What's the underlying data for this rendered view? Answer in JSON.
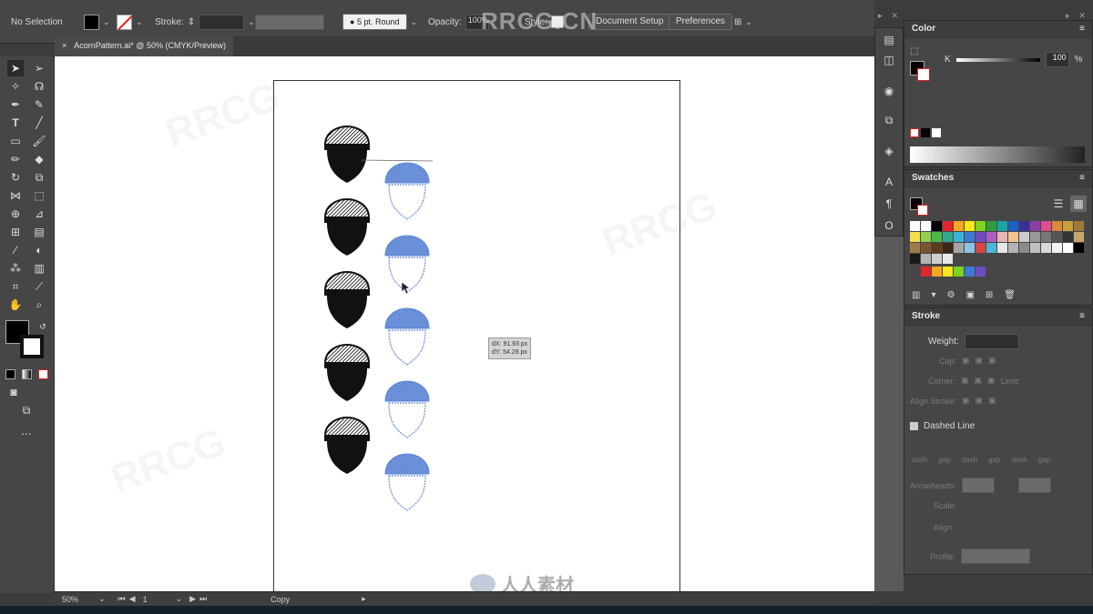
{
  "control_bar": {
    "selection": "No Selection",
    "stroke_label": "Stroke:",
    "brush": "5 pt. Round",
    "opacity_label": "Opacity:",
    "opacity_value": "100%",
    "style_label": "Style:",
    "document_setup": "Document Setup",
    "preferences": "Preferences"
  },
  "watermark": "RRCG.CN",
  "doc_tab": {
    "title": "AcornPattern.ai* @ 50% (CMYK/Preview)",
    "close": "×"
  },
  "tooltip": {
    "dx": "dX: 91.93 px",
    "dy": "dY: 54.28 px"
  },
  "status": {
    "zoom": "50%",
    "artboard": "1",
    "mode": "Copy"
  },
  "color_panel": {
    "title": "Color",
    "channel": "K",
    "value": "100",
    "unit": "%"
  },
  "swatches_panel": {
    "title": "Swatches"
  },
  "stroke_panel": {
    "title": "Stroke",
    "weight": "Weight:",
    "cap": "Cap:",
    "corner": "Corner:",
    "limit": "Limit:",
    "align": "Align Stroke:",
    "dashed": "Dashed Line",
    "dash_labels": [
      "dash",
      "gap",
      "dash",
      "gap",
      "dash",
      "gap"
    ],
    "arrowheads": "Arrowheads:",
    "scale": "Scale:",
    "align2": "Align:",
    "profile": "Profile:"
  },
  "bottom_logo": "人人素材",
  "colors": {
    "acorn_black": "#111111",
    "acorn_blue": "#5b86d6",
    "panel": "#464646",
    "canvas": "#ffffff"
  },
  "swatch_colors": [
    "#ffffff",
    "#ffffff",
    "#000000",
    "#e3262b",
    "#f5a623",
    "#f8e71c",
    "#7ed321",
    "#2e9b3f",
    "#1aa6a6",
    "#1f5fbf",
    "#3a2f9b",
    "#8b3fa6",
    "#e04c8d",
    "#d98b3a",
    "#c8a13a",
    "#9b7a3a",
    "#f2e04a",
    "#8fd14f",
    "#4fb84a",
    "#34a88e",
    "#3bb3d9",
    "#3d79d1",
    "#6d4bc2",
    "#b25bc4",
    "#e8b5b5",
    "#f2c48e",
    "#cccccc",
    "#999999",
    "#777777",
    "#555555",
    "#333333",
    "#c7a66b",
    "#a07a4a",
    "#7a5530",
    "#5a3b20",
    "#3d2612",
    "#a6a6a6",
    "#8cc4e8",
    "#d64545",
    "#4ab8d6",
    "#e6e6e6",
    "#b3b3b3",
    "#8a8a8a",
    "#c0c0c0",
    "#d9d9d9",
    "#f0f0f0",
    "#ffffff",
    "#000000",
    "#1a1a1a",
    "#b3b3b3",
    "#cfcfcf",
    "#e8e8e8"
  ],
  "swatch_row6": [
    "#e3262b",
    "#f5a623",
    "#f8e71c",
    "#7ed321",
    "#3d79d1",
    "#6d4bc2"
  ]
}
